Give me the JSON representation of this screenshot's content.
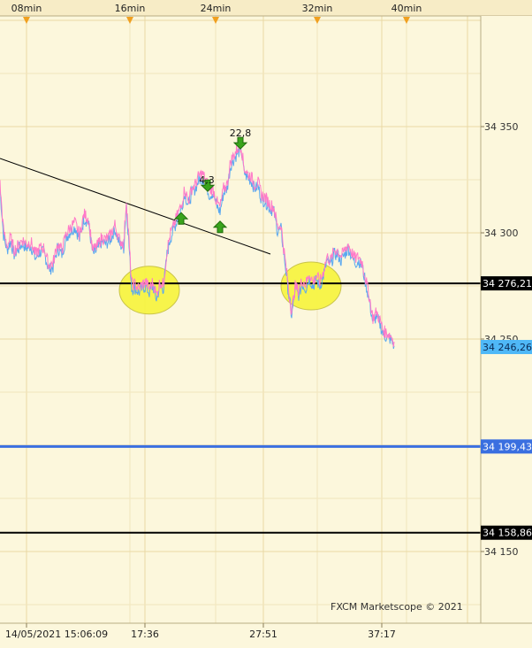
{
  "chart_data": {
    "type": "line",
    "instrument_note": "",
    "top_time_labels": [
      "08min",
      "16min",
      "24min",
      "32min",
      "40min"
    ],
    "bottom_time_labels": [
      "14/05/2021 15:06:09",
      "17:36",
      "27:51",
      "37:17"
    ],
    "y_ticks": [
      34350,
      34300,
      34250,
      34150
    ],
    "y_tick_labels": [
      "34 350",
      "34 300",
      "34 250",
      "34 150"
    ],
    "ylim": [
      34125,
      34430
    ],
    "grid": true,
    "price_series": {
      "name": "",
      "colors": {
        "bid": "#ff7ac8",
        "ask": "#5aa8f0"
      },
      "points": [
        [
          0,
          34322
        ],
        [
          4,
          34300
        ],
        [
          8,
          34293
        ],
        [
          12,
          34297
        ],
        [
          16,
          34291
        ],
        [
          20,
          34293
        ],
        [
          25,
          34296
        ],
        [
          30,
          34294
        ],
        [
          35,
          34295
        ],
        [
          40,
          34289
        ],
        [
          45,
          34292
        ],
        [
          50,
          34292
        ],
        [
          55,
          34284
        ],
        [
          60,
          34285
        ],
        [
          65,
          34294
        ],
        [
          70,
          34291
        ],
        [
          75,
          34299
        ],
        [
          80,
          34302
        ],
        [
          85,
          34304
        ],
        [
          90,
          34298
        ],
        [
          95,
          34308
        ],
        [
          100,
          34306
        ],
        [
          105,
          34291
        ],
        [
          110,
          34293
        ],
        [
          115,
          34297
        ],
        [
          120,
          34296
        ],
        [
          125,
          34298
        ],
        [
          130,
          34303
        ],
        [
          135,
          34296
        ],
        [
          140,
          34294
        ],
        [
          143,
          34315
        ],
        [
          146,
          34295
        ],
        [
          149,
          34275
        ],
        [
          153,
          34275
        ],
        [
          157,
          34273
        ],
        [
          161,
          34275
        ],
        [
          165,
          34276
        ],
        [
          169,
          34273
        ],
        [
          173,
          34276
        ],
        [
          177,
          34270
        ],
        [
          181,
          34276
        ],
        [
          185,
          34275
        ],
        [
          189,
          34291
        ],
        [
          193,
          34299
        ],
        [
          197,
          34303
        ],
        [
          201,
          34308
        ],
        [
          205,
          34312
        ],
        [
          209,
          34320
        ],
        [
          213,
          34314
        ],
        [
          217,
          34320
        ],
        [
          221,
          34322
        ],
        [
          225,
          34326
        ],
        [
          229,
          34327
        ],
        [
          233,
          34324
        ],
        [
          237,
          34319
        ],
        [
          241,
          34320
        ],
        [
          245,
          34314
        ],
        [
          249,
          34311
        ],
        [
          253,
          34320
        ],
        [
          257,
          34322
        ],
        [
          261,
          34333
        ],
        [
          265,
          34336
        ],
        [
          269,
          34339
        ],
        [
          273,
          34340
        ],
        [
          276,
          34330
        ],
        [
          280,
          34327
        ],
        [
          284,
          34326
        ],
        [
          288,
          34322
        ],
        [
          292,
          34323
        ],
        [
          296,
          34317
        ],
        [
          300,
          34316
        ],
        [
          305,
          34313
        ],
        [
          310,
          34311
        ],
        [
          314,
          34302
        ],
        [
          318,
          34303
        ],
        [
          321,
          34292
        ],
        [
          324,
          34282
        ],
        [
          327,
          34271
        ],
        [
          330,
          34262
        ],
        [
          334,
          34274
        ],
        [
          338,
          34272
        ],
        [
          342,
          34277
        ],
        [
          346,
          34275
        ],
        [
          350,
          34280
        ],
        [
          354,
          34276
        ],
        [
          358,
          34279
        ],
        [
          362,
          34276
        ],
        [
          366,
          34281
        ],
        [
          370,
          34288
        ],
        [
          374,
          34286
        ],
        [
          378,
          34291
        ],
        [
          382,
          34291
        ],
        [
          386,
          34288
        ],
        [
          390,
          34291
        ],
        [
          394,
          34294
        ],
        [
          398,
          34290
        ],
        [
          402,
          34287
        ],
        [
          406,
          34288
        ],
        [
          410,
          34285
        ],
        [
          414,
          34277
        ],
        [
          418,
          34269
        ],
        [
          422,
          34259
        ],
        [
          426,
          34262
        ],
        [
          430,
          34258
        ],
        [
          434,
          34253
        ],
        [
          438,
          34252
        ],
        [
          442,
          34251
        ],
        [
          446,
          34248
        ]
      ]
    },
    "horizontal_levels": [
      {
        "value": 34276.21,
        "label": "34 276,21",
        "color": "#000000"
      },
      {
        "value": 34246.26,
        "label": "34 246,26",
        "color": "#4fb0f5",
        "current_price": true
      },
      {
        "value": 34199.43,
        "label": "34 199,43",
        "color": "#3a6fe0"
      },
      {
        "value": 34158.86,
        "label": "34 158,86",
        "color": "#000000"
      }
    ],
    "trendline": {
      "start": [
        0,
        34335
      ],
      "end": [
        306,
        34290
      ],
      "color": "#000000"
    },
    "annotations": [
      {
        "text": "22,8",
        "x": 272,
        "value": 34347
      },
      {
        "text": "4,3",
        "x": 234,
        "value": 34325
      }
    ],
    "signal_arrows": [
      {
        "direction": "down",
        "x": 272,
        "value": 34342
      },
      {
        "direction": "down",
        "x": 235,
        "value": 34322
      },
      {
        "direction": "up",
        "x": 205,
        "value": 34307
      },
      {
        "direction": "up",
        "x": 249,
        "value": 34303
      }
    ],
    "highlights": [
      {
        "x_center": 169,
        "value_center": 34273,
        "label": ""
      },
      {
        "x_center": 352,
        "value_center": 34275,
        "label": ""
      }
    ],
    "watermark": "FXCM Marketscope © 2021"
  }
}
